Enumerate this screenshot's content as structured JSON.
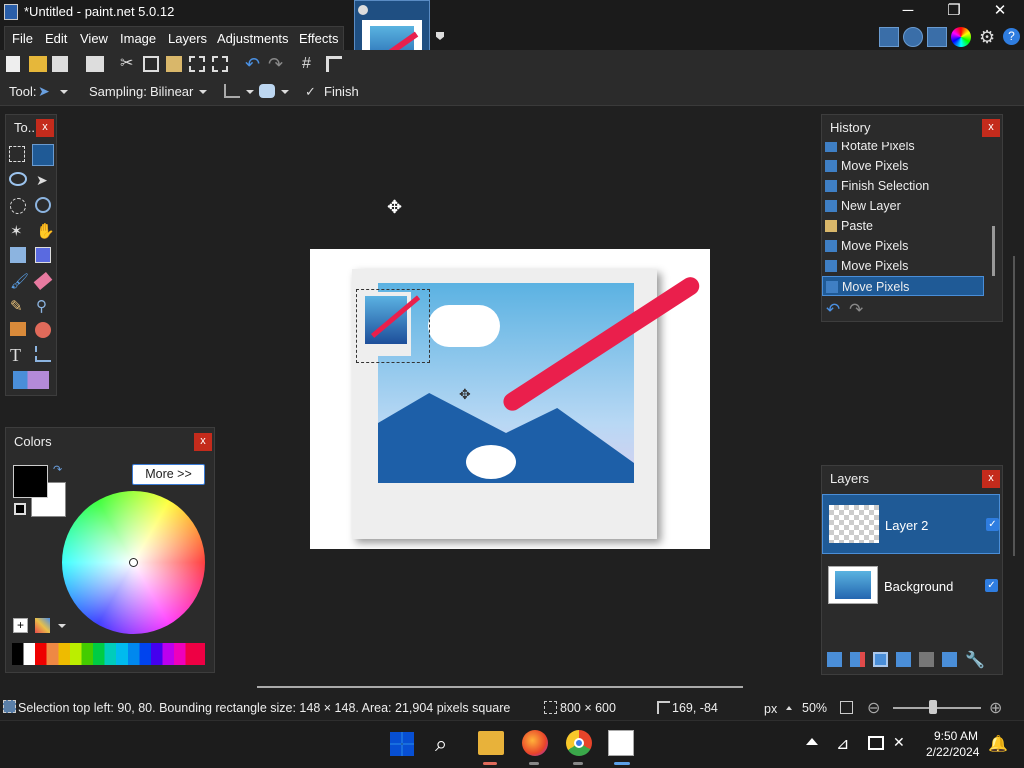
{
  "window": {
    "title": "*Untitled - paint.net 5.0.12",
    "minimize": "─",
    "maximize": "❐",
    "close": "✕"
  },
  "menu": [
    "File",
    "Edit",
    "View",
    "Image",
    "Layers",
    "Adjustments",
    "Effects"
  ],
  "tool_options": {
    "tool_label": "Tool:",
    "sampling_label": "Sampling:",
    "sampling_value": "Bilinear",
    "finish_label": "Finish"
  },
  "tools_panel": {
    "title": "To...",
    "close": "x"
  },
  "colors_panel": {
    "title": "Colors",
    "close": "x",
    "more_button": "More >>",
    "primary_color": "#000000",
    "secondary_color": "#ffffff"
  },
  "history_panel": {
    "title": "History",
    "close": "x",
    "items": [
      "Rotate Pixels",
      "Move Pixels",
      "Finish Selection",
      "New Layer",
      "Paste",
      "Move Pixels",
      "Move Pixels",
      "Move Pixels"
    ],
    "selected_index": 7
  },
  "layers_panel": {
    "title": "Layers",
    "close": "x",
    "layers": [
      {
        "name": "Layer 2",
        "visible": true,
        "selected": true
      },
      {
        "name": "Background",
        "visible": true,
        "selected": false
      }
    ]
  },
  "status": {
    "selection_info": "Selection top left: 90, 80. Bounding rectangle size: 148 × 148. Area: 21,904 pixels square",
    "image_size": "800 × 600",
    "cursor_pos": "169, -84",
    "units": "px",
    "zoom": "50%"
  },
  "taskbar": {
    "time": "9:50 AM",
    "date": "2/22/2024"
  },
  "colors": {
    "accent": "#1f5a96",
    "close_red": "#c42b1c",
    "panel_bg": "#2b2b2b"
  }
}
